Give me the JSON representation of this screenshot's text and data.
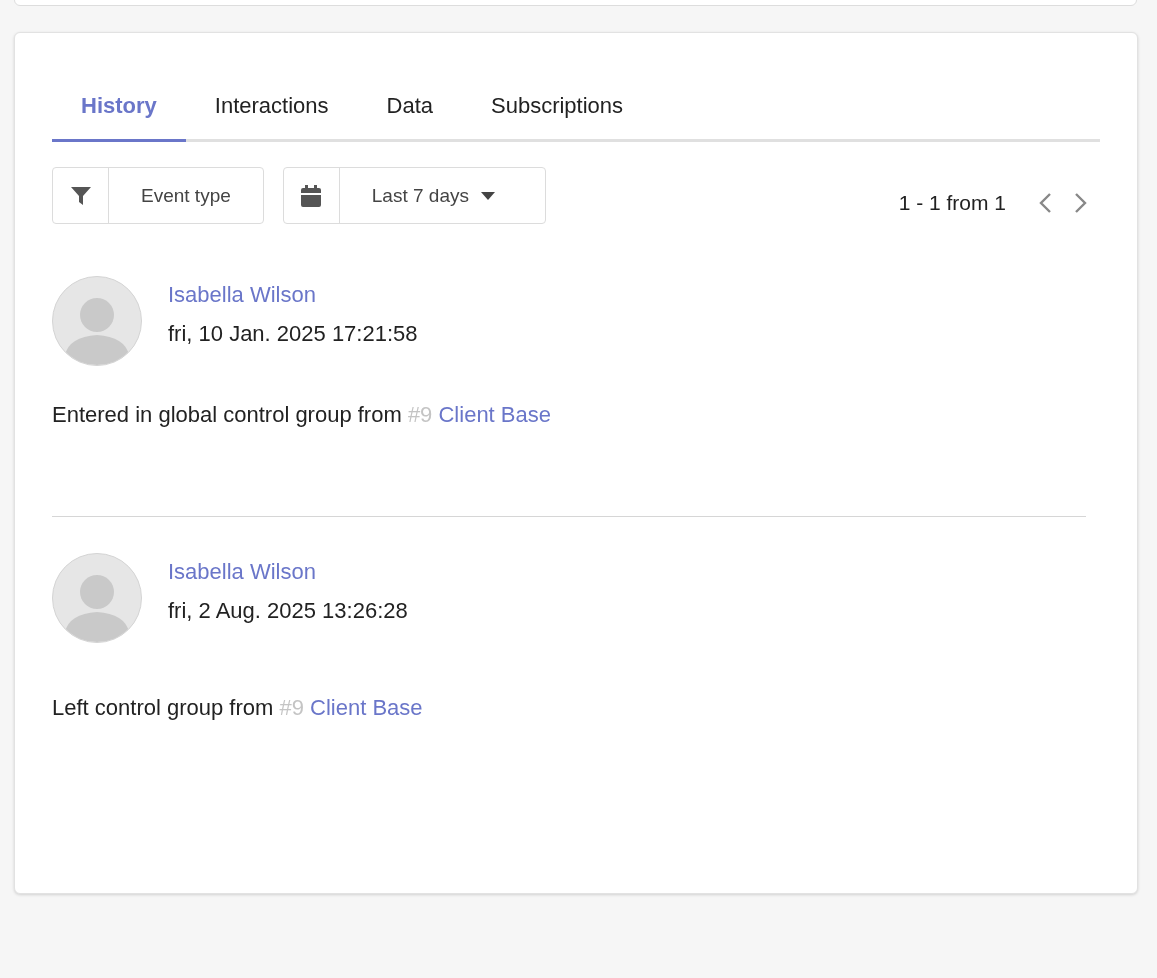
{
  "tabs": [
    {
      "label": "History",
      "selected": true
    },
    {
      "label": "Interactions",
      "selected": false
    },
    {
      "label": "Data",
      "selected": false
    },
    {
      "label": "Subscriptions",
      "selected": false
    }
  ],
  "filters": [
    {
      "kind": "filter",
      "label": "Event type",
      "caret": false
    },
    {
      "kind": "date",
      "label": "Last 7 days",
      "caret": true
    }
  ],
  "pagination": {
    "range": "1 - 1 from 1"
  },
  "events": [
    {
      "author": "Isabella Wilson",
      "time": "fri, 10 Jan. 2025 17:21:58",
      "text": "Entered in global control group from",
      "ref": "#9",
      "link": "Client Base"
    },
    {
      "author": "Isabella Wilson",
      "time": "fri, 2 Aug. 2025 13:26:28",
      "text": "Left control group from",
      "ref": "#9",
      "link": "Client Base"
    }
  ]
}
